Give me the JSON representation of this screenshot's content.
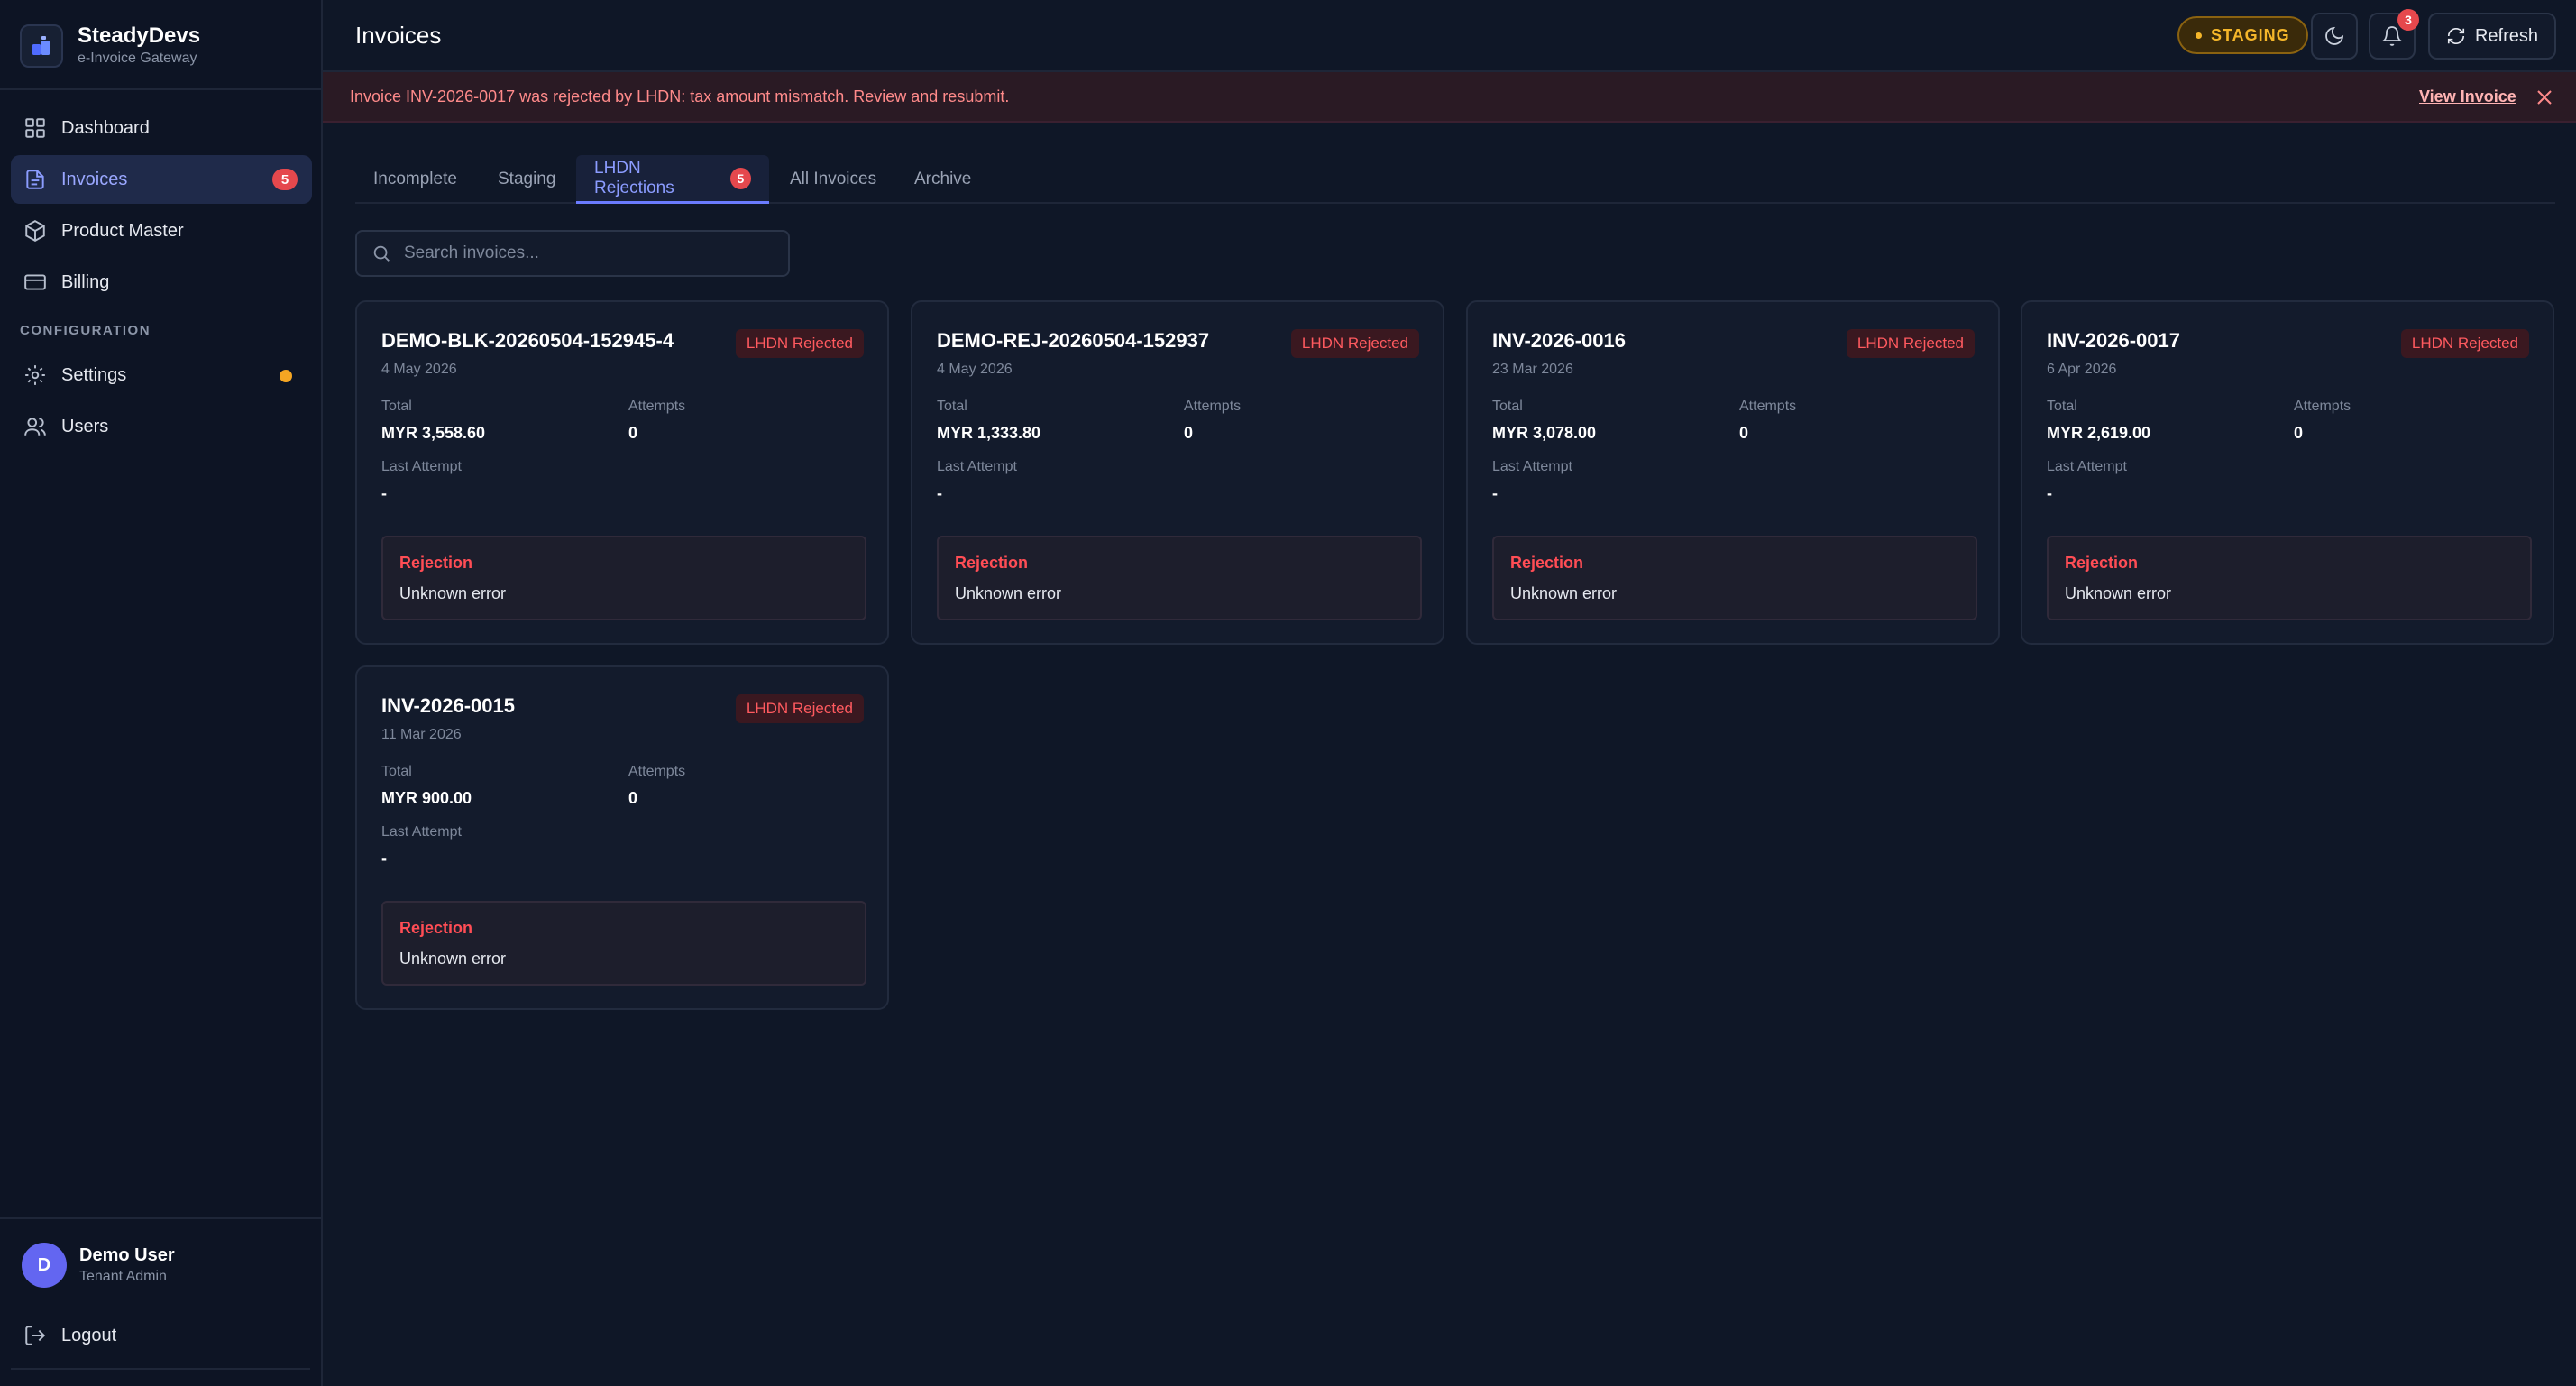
{
  "brand": {
    "name": "SteadyDevs",
    "subtitle": "e-Invoice Gateway"
  },
  "sidebar": {
    "items": [
      {
        "label": "Dashboard",
        "icon": "grid-icon"
      },
      {
        "label": "Invoices",
        "icon": "file-text-icon",
        "badge": "5",
        "active": true
      },
      {
        "label": "Product Master",
        "icon": "box-icon"
      },
      {
        "label": "Billing",
        "icon": "credit-card-icon"
      },
      {
        "label": "Settings",
        "icon": "gear-icon"
      },
      {
        "label": "Users",
        "icon": "users-icon"
      }
    ],
    "section_label": "CONFIGURATION",
    "user": {
      "initial": "D",
      "name": "Demo User",
      "role": "Tenant Admin"
    },
    "logout_label": "Logout"
  },
  "header": {
    "title": "Invoices",
    "env_badge": "STAGING",
    "notification_count": "3",
    "refresh_label": "Refresh"
  },
  "alert": {
    "message": "Invoice INV-2026-0017 was rejected by LHDN: tax amount mismatch. Review and resubmit.",
    "link_label": "View Invoice"
  },
  "tabs": [
    {
      "label": "Incomplete"
    },
    {
      "label": "Staging"
    },
    {
      "label": "LHDN Rejections",
      "badge": "5",
      "active": true
    },
    {
      "label": "All Invoices"
    },
    {
      "label": "Archive"
    }
  ],
  "search": {
    "placeholder": "Search invoices...",
    "value": ""
  },
  "labels": {
    "total": "Total",
    "attempts": "Attempts",
    "last_attempt": "Last Attempt",
    "rejection": "Rejection"
  },
  "invoices": [
    {
      "id": "DEMO-BLK-20260504-152945-4",
      "date": "4 May 2026",
      "status": "LHDN Rejected",
      "total": "MYR 3,558.60",
      "attempts": "0",
      "last_attempt": "-",
      "rejection_reason": "Unknown error"
    },
    {
      "id": "DEMO-REJ-20260504-152937",
      "date": "4 May 2026",
      "status": "LHDN Rejected",
      "total": "MYR 1,333.80",
      "attempts": "0",
      "last_attempt": "-",
      "rejection_reason": "Unknown error"
    },
    {
      "id": "INV-2026-0016",
      "date": "23 Mar 2026",
      "status": "LHDN Rejected",
      "total": "MYR 3,078.00",
      "attempts": "0",
      "last_attempt": "-",
      "rejection_reason": "Unknown error"
    },
    {
      "id": "INV-2026-0017",
      "date": "6 Apr 2026",
      "status": "LHDN Rejected",
      "total": "MYR 2,619.00",
      "attempts": "0",
      "last_attempt": "-",
      "rejection_reason": "Unknown error"
    },
    {
      "id": "INV-2026-0015",
      "date": "11 Mar 2026",
      "status": "LHDN Rejected",
      "total": "MYR 900.00",
      "attempts": "0",
      "last_attempt": "-",
      "rejection_reason": "Unknown error"
    }
  ],
  "colors": {
    "accent": "#6b7cff",
    "danger": "#e5484d",
    "warning": "#f5a623",
    "background": "#0f1727"
  }
}
